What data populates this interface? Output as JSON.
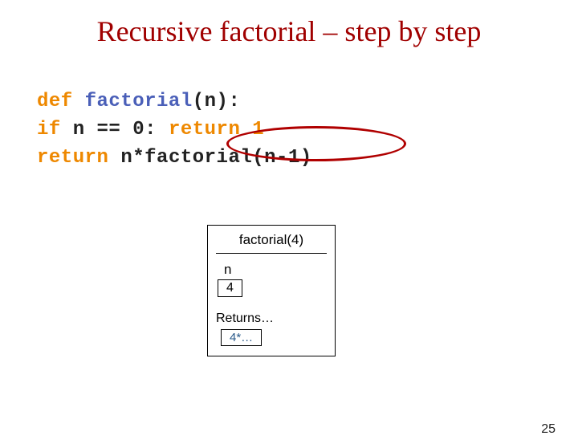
{
  "title": "Recursive factorial – step by step",
  "code": {
    "line1": {
      "kw": "def ",
      "fn": "factorial",
      "rest": "(n):"
    },
    "line2": {
      "indent": "    ",
      "kw": "if ",
      "cond": "n == 0: ",
      "ret": "return 1"
    },
    "line3": {
      "indent": "    ",
      "ret": "return ",
      "expr": "n*factorial(n-1)"
    }
  },
  "frame": {
    "title": "factorial(4)",
    "var_label": "n",
    "var_value": "4",
    "returns_label": "Returns…",
    "returns_value": "4*…"
  },
  "page_number": "25"
}
